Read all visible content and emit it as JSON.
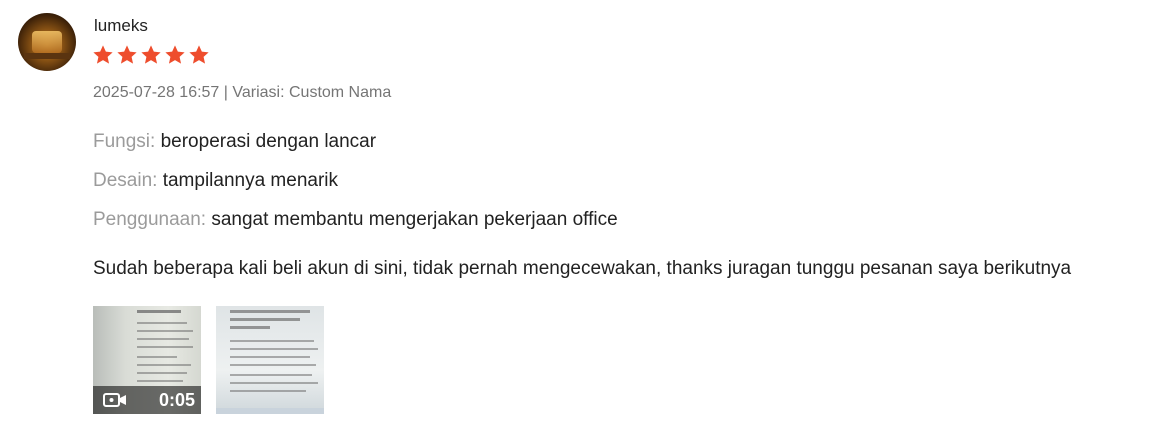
{
  "review": {
    "username": "lumeks",
    "rating": 5,
    "rating_color": "#ee4d2d",
    "meta": "2025-07-28 16:57 | Variasi: Custom Nama",
    "attributes": [
      {
        "label": "Fungsi:",
        "value": "beroperasi dengan lancar"
      },
      {
        "label": "Desain:",
        "value": "tampilannya menarik"
      },
      {
        "label": "Penggunaan:",
        "value": "sangat membantu mengerjakan pekerjaan office"
      }
    ],
    "comment": "Sudah beberapa kali beli akun di sini, tidak pernah mengecewakan, thanks juragan tunggu pesanan saya berikutnya",
    "media": [
      {
        "type": "video",
        "duration": "0:05",
        "icon": "video-camera-icon"
      },
      {
        "type": "image"
      }
    ]
  }
}
